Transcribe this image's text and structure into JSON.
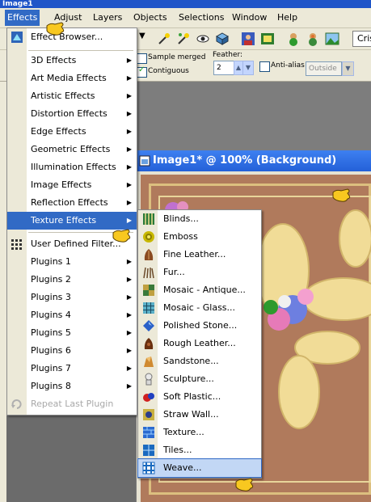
{
  "app": {
    "title": "Image1"
  },
  "menubar": {
    "items": [
      {
        "label": "Effects"
      },
      {
        "label": "Adjust"
      },
      {
        "label": "Layers"
      },
      {
        "label": "Objects"
      },
      {
        "label": "Selections"
      },
      {
        "label": "Window"
      },
      {
        "label": "Help"
      }
    ]
  },
  "toolbar": {
    "right_button": "Cris"
  },
  "options": {
    "sample_merged_label": "Sample merged",
    "contiguous_label": "Contiguous",
    "feather_label": "Feather:",
    "feather_value": "2",
    "antialias_label": "Anti-alias",
    "outside_value": "Outside"
  },
  "effects_menu": {
    "items": [
      {
        "label": "Effect Browser..."
      },
      {
        "label": "3D Effects"
      },
      {
        "label": "Art Media Effects"
      },
      {
        "label": "Artistic Effects"
      },
      {
        "label": "Distortion Effects"
      },
      {
        "label": "Edge Effects"
      },
      {
        "label": "Geometric Effects"
      },
      {
        "label": "Illumination Effects"
      },
      {
        "label": "Image Effects"
      },
      {
        "label": "Reflection Effects"
      },
      {
        "label": "Texture Effects"
      },
      {
        "label": "User Defined Filter..."
      },
      {
        "label": "Plugins 1"
      },
      {
        "label": "Plugins 2"
      },
      {
        "label": "Plugins 3"
      },
      {
        "label": "Plugins 4"
      },
      {
        "label": "Plugins 5"
      },
      {
        "label": "Plugins 6"
      },
      {
        "label": "Plugins 7"
      },
      {
        "label": "Plugins 8"
      },
      {
        "label": "Repeat Last Plugin"
      }
    ]
  },
  "texture_menu": {
    "items": [
      {
        "label": "Blinds..."
      },
      {
        "label": "Emboss"
      },
      {
        "label": "Fine Leather..."
      },
      {
        "label": "Fur..."
      },
      {
        "label": "Mosaic - Antique..."
      },
      {
        "label": "Mosaic - Glass..."
      },
      {
        "label": "Polished Stone..."
      },
      {
        "label": "Rough Leather..."
      },
      {
        "label": "Sandstone..."
      },
      {
        "label": "Sculpture..."
      },
      {
        "label": "Soft Plastic..."
      },
      {
        "label": "Straw Wall..."
      },
      {
        "label": "Texture..."
      },
      {
        "label": "Tiles..."
      },
      {
        "label": "Weave..."
      }
    ]
  },
  "image_window": {
    "title": "Image1* @ 100% (Background)"
  },
  "colors": {
    "menu_highlight": "#316ac5",
    "canvas_brown": "#b07a5c",
    "frame_gold": "#dcbf7f"
  }
}
